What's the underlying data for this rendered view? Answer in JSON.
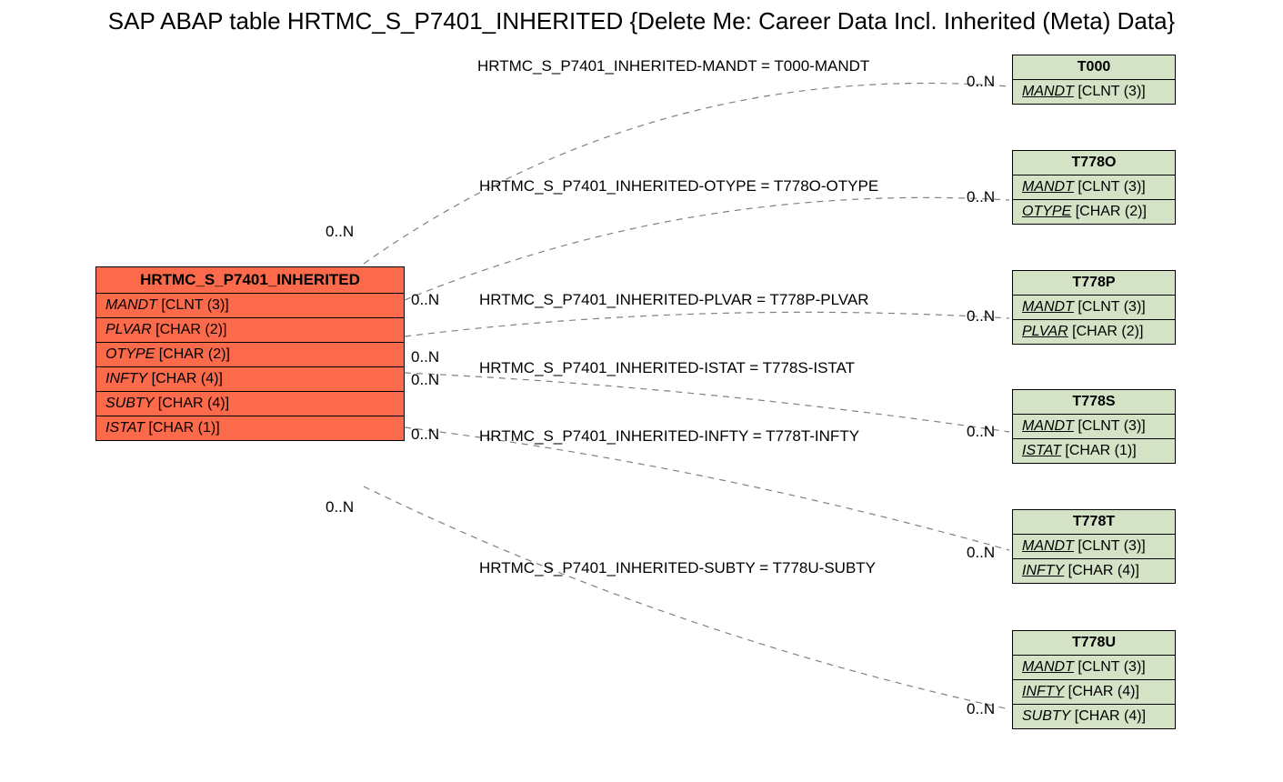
{
  "title": "SAP ABAP table HRTMC_S_P7401_INHERITED {Delete Me: Career Data Incl. Inherited (Meta) Data}",
  "main": {
    "name": "HRTMC_S_P7401_INHERITED",
    "fields": [
      {
        "name": "MANDT",
        "type": "[CLNT (3)]",
        "key": false
      },
      {
        "name": "PLVAR",
        "type": "[CHAR (2)]",
        "key": false
      },
      {
        "name": "OTYPE",
        "type": "[CHAR (2)]",
        "key": false
      },
      {
        "name": "INFTY",
        "type": "[CHAR (4)]",
        "key": false
      },
      {
        "name": "SUBTY",
        "type": "[CHAR (4)]",
        "key": false
      },
      {
        "name": "ISTAT",
        "type": "[CHAR (1)]",
        "key": false
      }
    ]
  },
  "refs": [
    {
      "name": "T000",
      "fields": [
        {
          "name": "MANDT",
          "type": "[CLNT (3)]",
          "key": true
        }
      ]
    },
    {
      "name": "T778O",
      "fields": [
        {
          "name": "MANDT",
          "type": "[CLNT (3)]",
          "key": true
        },
        {
          "name": "OTYPE",
          "type": "[CHAR (2)]",
          "key": true
        }
      ]
    },
    {
      "name": "T778P",
      "fields": [
        {
          "name": "MANDT",
          "type": "[CLNT (3)]",
          "key": true
        },
        {
          "name": "PLVAR",
          "type": "[CHAR (2)]",
          "key": true
        }
      ]
    },
    {
      "name": "T778S",
      "fields": [
        {
          "name": "MANDT",
          "type": "[CLNT (3)]",
          "key": true
        },
        {
          "name": "ISTAT",
          "type": "[CHAR (1)]",
          "key": true
        }
      ]
    },
    {
      "name": "T778T",
      "fields": [
        {
          "name": "MANDT",
          "type": "[CLNT (3)]",
          "key": true
        },
        {
          "name": "INFTY",
          "type": "[CHAR (4)]",
          "key": true
        }
      ]
    },
    {
      "name": "T778U",
      "fields": [
        {
          "name": "MANDT",
          "type": "[CLNT (3)]",
          "key": true
        },
        {
          "name": "INFTY",
          "type": "[CHAR (4)]",
          "key": true
        },
        {
          "name": "SUBTY",
          "type": "[CHAR (4)]",
          "key": false
        }
      ]
    }
  ],
  "edges": [
    {
      "label": "HRTMC_S_P7401_INHERITED-MANDT = T000-MANDT",
      "leftCard": "0..N",
      "rightCard": "0..N"
    },
    {
      "label": "HRTMC_S_P7401_INHERITED-OTYPE = T778O-OTYPE",
      "leftCard": "0..N",
      "rightCard": "0..N"
    },
    {
      "label": "HRTMC_S_P7401_INHERITED-PLVAR = T778P-PLVAR",
      "leftCard": "0..N",
      "rightCard": "0..N"
    },
    {
      "label": "HRTMC_S_P7401_INHERITED-ISTAT = T778S-ISTAT",
      "leftCard": "0..N",
      "rightCard": "0..N"
    },
    {
      "label": "HRTMC_S_P7401_INHERITED-INFTY = T778T-INFTY",
      "leftCard": "0..N",
      "rightCard": "0..N"
    },
    {
      "label": "HRTMC_S_P7401_INHERITED-SUBTY = T778U-SUBTY",
      "leftCard": "0..N",
      "rightCard": "0..N"
    }
  ]
}
